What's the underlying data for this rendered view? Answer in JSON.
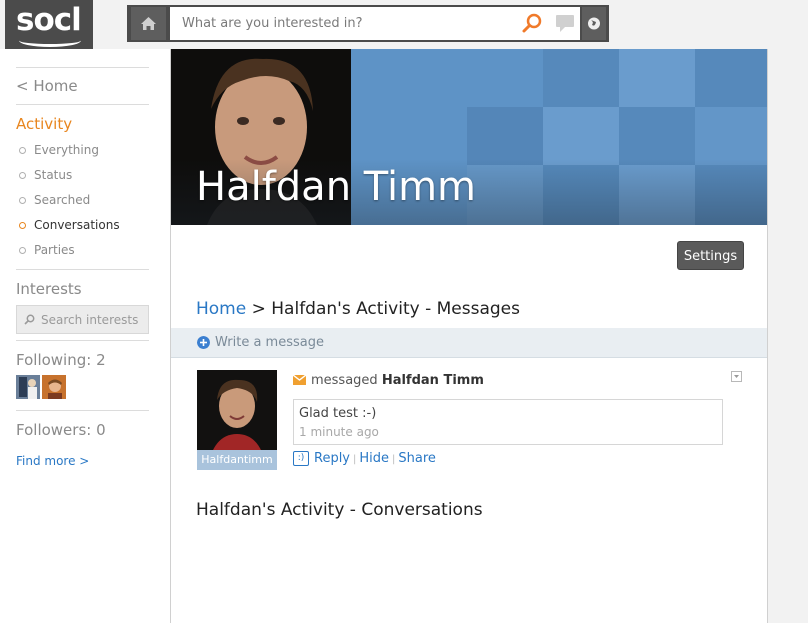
{
  "app": {
    "logo_text": "socl"
  },
  "search": {
    "placeholder": "What are you interested in?"
  },
  "sidebar": {
    "home_link": "< Home",
    "activity_title": "Activity",
    "activity_items": [
      {
        "label": "Everything",
        "active": false
      },
      {
        "label": "Status",
        "active": false
      },
      {
        "label": "Searched",
        "active": false
      },
      {
        "label": "Conversations",
        "active": true
      },
      {
        "label": "Parties",
        "active": false
      }
    ],
    "interests_title": "Interests",
    "interests_search_placeholder": "Search interests",
    "following_label": "Following: 2",
    "followers_label": "Followers: 0",
    "find_more": "Find more >"
  },
  "profile": {
    "name": "Halfdan Timm"
  },
  "toolbar": {
    "settings_label": "Settings"
  },
  "breadcrumb": {
    "home": "Home",
    "separator": " > ",
    "current": "Halfdan's Activity - Messages"
  },
  "write_bar": {
    "label": "Write a message"
  },
  "message": {
    "avatar_label": "Halfdantimm",
    "verb": "messaged",
    "recipient": "Halfdan Timm",
    "text": "Glad test :-)",
    "time": "1 minute ago",
    "actions": {
      "reply": "Reply",
      "hide": "Hide",
      "share": "Share"
    }
  },
  "conversations": {
    "title": "Halfdan's Activity - Conversations"
  },
  "colors": {
    "accent": "#e8861f",
    "link": "#2a78c5",
    "banner": "#5e93c6"
  }
}
